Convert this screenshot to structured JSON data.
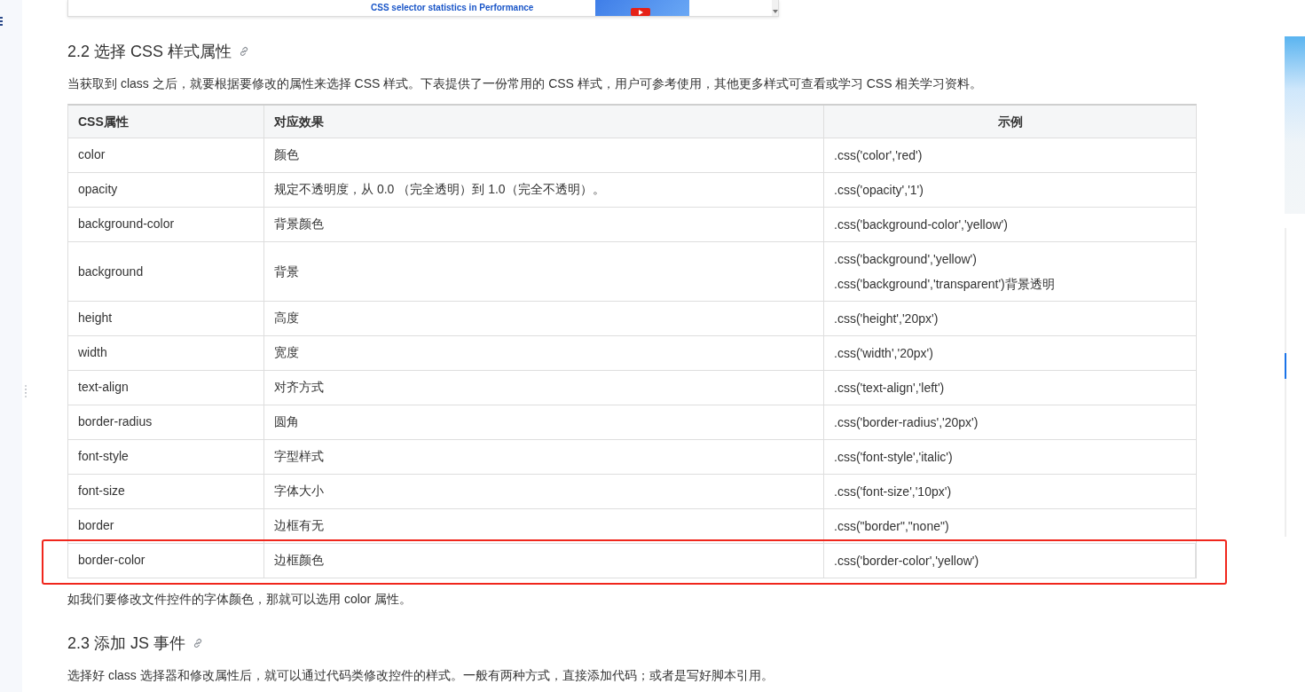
{
  "article_image": {
    "title": "CSS selector statistics in Performance"
  },
  "blocks": [
    {
      "kind": "heading",
      "text": "2.2 选择 CSS 样式属性"
    },
    {
      "kind": "paragraph",
      "text": "当获取到 class 之后，就要根据要修改的属性来选择 CSS 样式。下表提供了一份常用的 CSS 样式，用户可参考使用，其他更多样式可查看或学习 CSS 相关学习资料。"
    },
    {
      "kind": "table",
      "columns": [
        "CSS属性",
        "对应效果",
        "示例"
      ],
      "rows": [
        {
          "property": "color",
          "effect": "颜色",
          "examples": [
            ".css('color','red')"
          ],
          "highlighted": false
        },
        {
          "property": "opacity",
          "effect": "规定不透明度，从 0.0 （完全透明）到 1.0（完全不透明）。",
          "examples": [
            ".css('opacity','1')"
          ],
          "highlighted": false
        },
        {
          "property": "background-color",
          "effect": "背景颜色",
          "examples": [
            ".css('background-color','yellow')"
          ],
          "highlighted": false
        },
        {
          "property": "background",
          "effect": "背景",
          "examples": [
            ".css('background','yellow')",
            ".css('background','transparent')背景透明"
          ],
          "highlighted": false
        },
        {
          "property": "height",
          "effect": "高度",
          "examples": [
            ".css('height','20px')"
          ],
          "highlighted": false
        },
        {
          "property": "width",
          "effect": "宽度",
          "examples": [
            ".css('width','20px')"
          ],
          "highlighted": false
        },
        {
          "property": "text-align",
          "effect": "对齐方式",
          "examples": [
            ".css('text-align','left')"
          ],
          "highlighted": false
        },
        {
          "property": "border-radius",
          "effect": "圆角",
          "examples": [
            ".css('border-radius','20px')"
          ],
          "highlighted": false
        },
        {
          "property": "font-style",
          "effect": "字型样式",
          "examples": [
            ".css('font-style','italic')"
          ],
          "highlighted": false
        },
        {
          "property": "font-size",
          "effect": "字体大小",
          "examples": [
            ".css('font-size','10px')"
          ],
          "highlighted": false
        },
        {
          "property": "border",
          "effect": "边框有无",
          "examples": [
            ".css(\"border\",\"none\")"
          ],
          "highlighted": false
        },
        {
          "property": "border-color",
          "effect": "边框颜色",
          "examples": [
            ".css('border-color','yellow')"
          ],
          "highlighted": true
        }
      ]
    },
    {
      "kind": "paragraph",
      "text": "如我们要修改文件控件的字体颜色，那就可以选用 color 属性。"
    },
    {
      "kind": "heading",
      "text": "2.3 添加 JS 事件"
    },
    {
      "kind": "paragraph",
      "text": "选择好 class 选择器和修改属性后，就可以通过代码类修改控件的样式。一般有两种方式，直接添加代码；或者是写好脚本引用。"
    }
  ]
}
